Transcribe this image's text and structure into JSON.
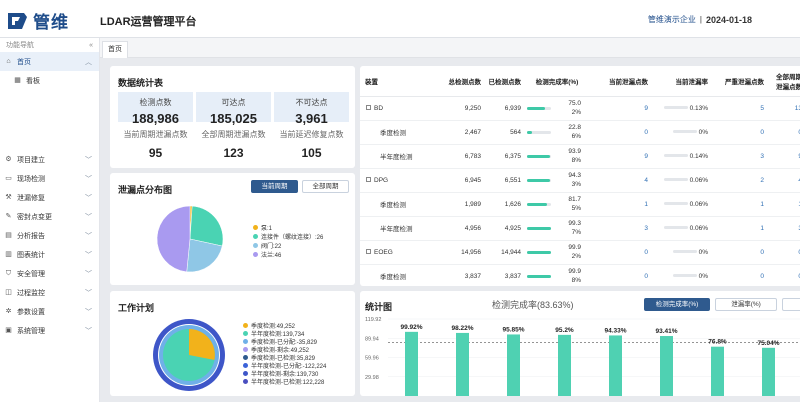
{
  "header": {
    "logo_text": "管维",
    "app_title": "LDAR运营管理平台",
    "enterprise": "管维演示企业",
    "separator": "|",
    "date": "2024-01-18"
  },
  "sidebar": {
    "nav_label": "功能导航",
    "collapse_icon": "double-chevron-left-icon",
    "items": [
      {
        "label": "首页",
        "icon": "home-icon",
        "active": true
      },
      {
        "label": "看板",
        "icon": "dashboard-icon",
        "sub": true
      },
      {
        "label": "项目建立",
        "icon": "gear-icon"
      },
      {
        "label": "现场检测",
        "icon": "monitor-icon"
      },
      {
        "label": "泄漏修复",
        "icon": "wrench-icon"
      },
      {
        "label": "密封点变更",
        "icon": "pencil-icon"
      },
      {
        "label": "分析报告",
        "icon": "report-icon"
      },
      {
        "label": "图表统计",
        "icon": "chart-icon"
      },
      {
        "label": "安全管理",
        "icon": "shield-icon"
      },
      {
        "label": "过程监控",
        "icon": "lock-icon"
      },
      {
        "label": "参数设置",
        "icon": "settings-icon"
      },
      {
        "label": "系统管理",
        "icon": "system-icon"
      }
    ]
  },
  "tabs": [
    "首页"
  ],
  "stats": {
    "title": "数据统计表",
    "cells": [
      {
        "label": "检测点数",
        "value": "188,986"
      },
      {
        "label": "可达点",
        "value": "185,025"
      },
      {
        "label": "不可达点",
        "value": "3,961"
      },
      {
        "label": "当前周期泄漏点数",
        "value": "95"
      },
      {
        "label": "全部周期泄漏点数",
        "value": "123"
      },
      {
        "label": "当前延迟修复点数",
        "value": "105"
      }
    ]
  },
  "leak_dist": {
    "title": "泄漏点分布图",
    "buttons": [
      "当前周期",
      "全部周期"
    ],
    "legend": [
      {
        "label": "泵:1",
        "color": "#f2b21b",
        "value": 1
      },
      {
        "label": "连接件（螺纹连接）:26",
        "color": "#4ad3b3",
        "value": 26
      },
      {
        "label": "阀门:22",
        "color": "#8fc7e6",
        "value": 22
      },
      {
        "label": "法兰:46",
        "color": "#a99af0",
        "value": 46
      }
    ]
  },
  "work_plan": {
    "title": "工作计划",
    "legend": [
      {
        "label": "季度检测:49,252",
        "color": "#f2b21b"
      },
      {
        "label": "半年度检测:139,734",
        "color": "#4ad3b3"
      },
      {
        "label": "季度检测-已分配:-35,829",
        "color": "#6fb0e8"
      },
      {
        "label": "季度检测-剩余:49,252",
        "color": "#a99af0"
      },
      {
        "label": "季度检测-已检测:35,829",
        "color": "#2f5a8e"
      },
      {
        "label": "半年度检测-已分配:-122,224",
        "color": "#3c63d8"
      },
      {
        "label": "半年度检测-剩余:139,730",
        "color": "#3e56c8"
      },
      {
        "label": "半年度检测-已检测:122,228",
        "color": "#4a4fbf"
      }
    ]
  },
  "table": {
    "headers": [
      "装置",
      "总检测点数",
      "已检测点数",
      "检测完成率(%)",
      "当前泄漏点数",
      "当前泄漏率",
      "严重泄漏点数",
      "全部周期泄漏点数"
    ],
    "rows": [
      {
        "name": "BD",
        "group": true,
        "total": "9,250",
        "done": "6,939",
        "rate_a": "75.0",
        "rate_b": "2%",
        "pct": 0.75,
        "leak": "9",
        "leak_rate": "0.13%",
        "severe": "5",
        "all": "13"
      },
      {
        "name": "季度检测",
        "group": false,
        "total": "2,467",
        "done": "564",
        "rate_a": "22.8",
        "rate_b": "6%",
        "pct": 0.228,
        "leak": "0",
        "leak_rate": "0%",
        "severe": "0",
        "all": "0"
      },
      {
        "name": "半年度检测",
        "group": false,
        "total": "6,783",
        "done": "6,375",
        "rate_a": "93.9",
        "rate_b": "8%",
        "pct": 0.939,
        "leak": "9",
        "leak_rate": "0.14%",
        "severe": "3",
        "all": "9"
      },
      {
        "name": "DPG",
        "group": true,
        "total": "6,945",
        "done": "6,551",
        "rate_a": "94.3",
        "rate_b": "3%",
        "pct": 0.943,
        "leak": "4",
        "leak_rate": "0.06%",
        "severe": "2",
        "all": "4"
      },
      {
        "name": "季度检测",
        "group": false,
        "total": "1,989",
        "done": "1,626",
        "rate_a": "81.7",
        "rate_b": "5%",
        "pct": 0.817,
        "leak": "1",
        "leak_rate": "0.06%",
        "severe": "1",
        "all": "1"
      },
      {
        "name": "半年度检测",
        "group": false,
        "total": "4,956",
        "done": "4,925",
        "rate_a": "99.3",
        "rate_b": "7%",
        "pct": 0.993,
        "leak": "3",
        "leak_rate": "0.06%",
        "severe": "1",
        "all": "3"
      },
      {
        "name": "EOEG",
        "group": true,
        "total": "14,956",
        "done": "14,944",
        "rate_a": "99.9",
        "rate_b": "2%",
        "pct": 0.999,
        "leak": "0",
        "leak_rate": "0%",
        "severe": "0",
        "all": "0"
      },
      {
        "name": "季度检测",
        "group": false,
        "total": "3,837",
        "done": "3,837",
        "rate_a": "99.9",
        "rate_b": "8%",
        "pct": 0.999,
        "leak": "0",
        "leak_rate": "0%",
        "severe": "0",
        "all": "0"
      }
    ]
  },
  "stat_chart": {
    "title": "统计图",
    "subtitle": "检测完成率(83.63%)",
    "buttons": [
      "检测完成率(%)",
      "泄漏率(%)"
    ]
  },
  "chart_data": {
    "type": "bar",
    "title": "",
    "subtitle": "检测完成率(83.63%)",
    "yticks": [
      "119.92",
      "89.94",
      "59.96",
      "29.98"
    ],
    "ylim": [
      0,
      119.92
    ],
    "values": [
      99.92,
      98.22,
      95.85,
      95.2,
      94.33,
      93.41,
      76.8,
      75.04
    ],
    "labels": [
      "99.92%",
      "98.22%",
      "95.85%",
      "95.2%",
      "94.33%",
      "93.41%",
      "76.8%",
      "75.04%"
    ],
    "reference": 83.63,
    "bar_color": "#4fd1b2"
  }
}
